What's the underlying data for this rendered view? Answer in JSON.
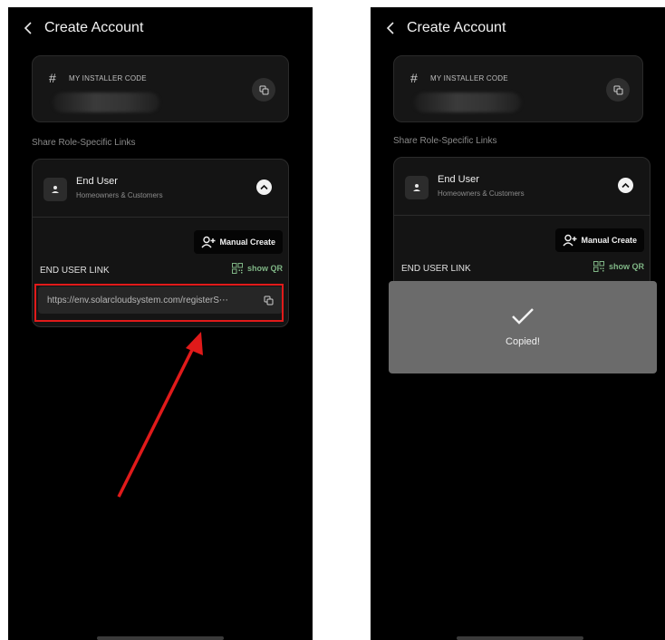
{
  "header": {
    "title": "Create Account"
  },
  "installer_code": {
    "label": "MY INSTALLER CODE"
  },
  "section_label": "Share Role-Specific Links",
  "role": {
    "name": "End User",
    "subtitle": "Homeowners & Customers"
  },
  "manual_create_label": "Manual Create",
  "end_user_link": {
    "label": "END USER LINK",
    "show_qr_label": "show QR",
    "url": "https://env.solarcloudsystem.com/registerS⋯"
  },
  "toast": {
    "message": "Copied!"
  },
  "colors": {
    "annotation": "#e01a1a",
    "accent_green": "#7fb585"
  }
}
